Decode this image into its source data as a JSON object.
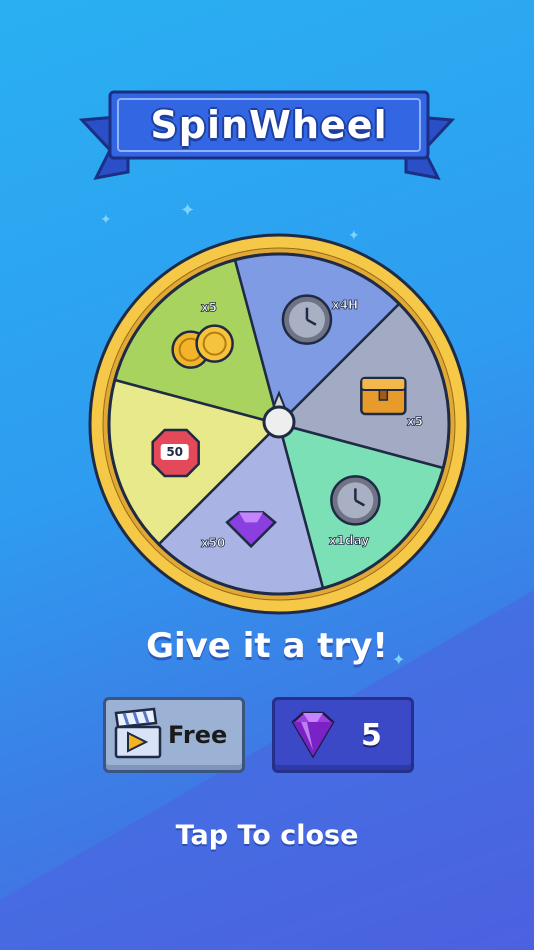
{
  "header": {
    "title": "SpinWheel"
  },
  "wheel": {
    "segments": [
      {
        "prize": "coins",
        "label": "x5",
        "icon": "coins-icon",
        "color": "#a9d35f"
      },
      {
        "prize": "clock",
        "label": "x4H",
        "icon": "clock-icon",
        "color": "#7f9be3"
      },
      {
        "prize": "chest",
        "label": "x5",
        "icon": "chest-icon",
        "color": "#a3abc4"
      },
      {
        "prize": "clock",
        "label": "x1day",
        "icon": "clock-icon",
        "color": "#7ce0b6"
      },
      {
        "prize": "gems",
        "label": "x50",
        "icon": "gem-icon",
        "color": "#a9b4e4"
      },
      {
        "prize": "sign",
        "label": "50",
        "icon": "sign-icon",
        "color": "#e7e98b"
      }
    ],
    "pointer_icon": "pointer-icon"
  },
  "tagline": "Give it a try!",
  "buttons": {
    "free_label": "Free",
    "free_icon": "video-ticket-icon",
    "gem_count": "5",
    "gem_icon": "gem-icon"
  },
  "footer": {
    "close_label": "Tap To close"
  },
  "colors": {
    "banner": "#2f5fd6",
    "rim": "#f2c14b",
    "free_button": "#9cb2d4",
    "gem_button": "#3b49c6"
  }
}
